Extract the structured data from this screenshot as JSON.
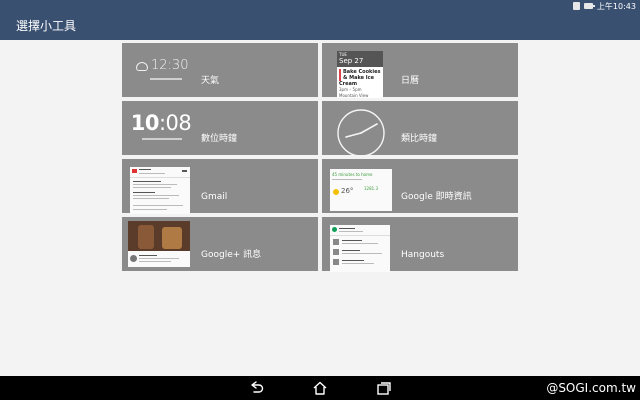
{
  "status_bar": {
    "time": "上午10:43",
    "icons": [
      "notification-icon",
      "battery-icon"
    ]
  },
  "header": {
    "title": "選擇小工具"
  },
  "widgets": [
    {
      "label": "天氣",
      "icon": "weather-preview",
      "preview_time": "12:30"
    },
    {
      "label": "日曆",
      "icon": "calendar-preview",
      "preview_day": "TUE",
      "preview_date": "Sep 27",
      "preview_event": "Bake Cookies & Make Ice Cream",
      "preview_time_range": "3pm – 5pm",
      "preview_location": "Mountain View"
    },
    {
      "label": "數位時鐘",
      "icon": "digital-clock-preview",
      "preview_hours": "10",
      "preview_minutes": "08"
    },
    {
      "label": "類比時鐘",
      "icon": "analog-clock-preview"
    },
    {
      "label": "Gmail",
      "icon": "gmail-preview"
    },
    {
      "label": "Google 即時資訊",
      "icon": "google-now-preview",
      "preview_commute": "45 minutes to home",
      "preview_temp": "26°",
      "preview_stock": "1281.3"
    },
    {
      "label": "Google+ 訊息",
      "icon": "google-plus-preview"
    },
    {
      "label": "Hangouts",
      "icon": "hangouts-preview"
    }
  ],
  "nav_bar": {
    "buttons": [
      "back-icon",
      "home-icon",
      "recents-icon"
    ],
    "watermark": "@SOGI.com.tw"
  }
}
